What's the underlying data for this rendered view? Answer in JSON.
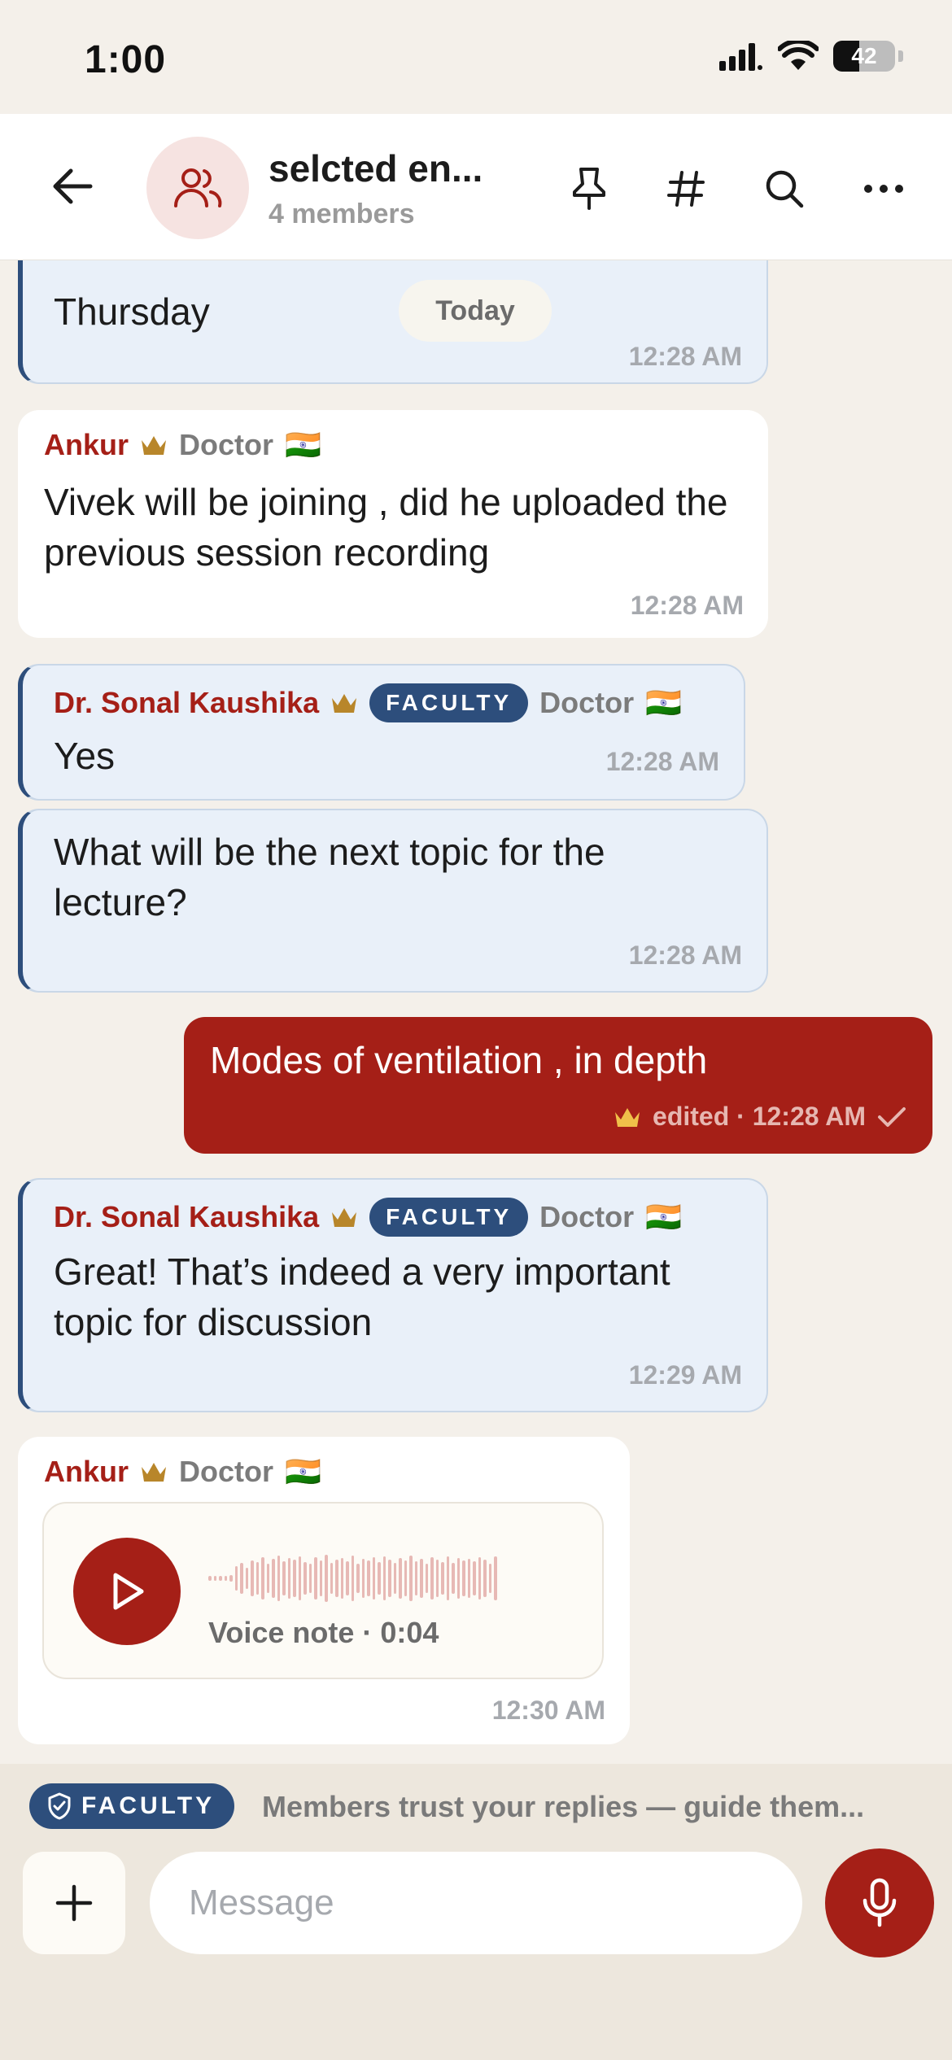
{
  "status_bar": {
    "time": "1:00",
    "battery_level": "42"
  },
  "header": {
    "title": "selcted en...",
    "subtitle": "4 members"
  },
  "date_divider": "Today",
  "messages": [
    {
      "kind": "faculty_continued",
      "text": "Thursday",
      "time": "12:28 AM"
    },
    {
      "kind": "incoming",
      "sender": "Ankur",
      "role": "Doctor",
      "flag": "🇮🇳",
      "text": "Vivek will be joining , did he uploaded the previous session recording",
      "time": "12:28 AM"
    },
    {
      "kind": "faculty",
      "sender": "Dr. Sonal Kaushika",
      "badge": "FACULTY",
      "role": "Doctor",
      "flag": "🇮🇳",
      "text": "Yes",
      "time": "12:28 AM"
    },
    {
      "kind": "faculty_grouped",
      "text": "What will be the next topic for the lecture?",
      "time": "12:28 AM"
    },
    {
      "kind": "outgoing",
      "text": "Modes of ventilation , in depth",
      "meta": "edited · 12:28 AM"
    },
    {
      "kind": "faculty",
      "sender": "Dr. Sonal Kaushika",
      "badge": "FACULTY",
      "role": "Doctor",
      "flag": "🇮🇳",
      "text": "Great! That’s indeed a very important topic for discussion",
      "time": "12:29 AM"
    },
    {
      "kind": "incoming_voice",
      "sender": "Ankur",
      "role": "Doctor",
      "flag": "🇮🇳",
      "voice_label": "Voice note · 0:04",
      "time": "12:30 AM"
    }
  ],
  "faculty_banner": {
    "badge": "FACULTY",
    "text": "Members trust your replies — guide them..."
  },
  "composer": {
    "placeholder": "Message"
  },
  "colors": {
    "brand_red": "#a51f17",
    "faculty_navy": "#2d4e7c",
    "crown_gold": "#b8862a",
    "background": "#f4f0ea"
  },
  "icons": [
    "back-arrow-icon",
    "group-icon",
    "pin-icon",
    "hashtag-icon",
    "search-icon",
    "more-icon",
    "crown-icon",
    "india-flag-icon",
    "play-icon",
    "checkmark-icon",
    "shield-icon",
    "plus-icon",
    "microphone-icon"
  ]
}
